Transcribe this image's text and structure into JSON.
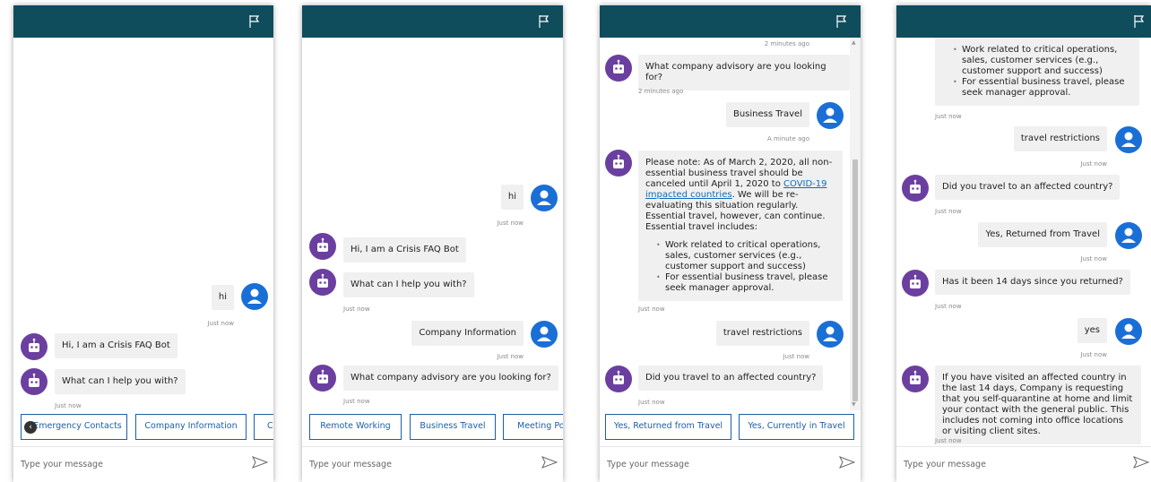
{
  "colors": {
    "header": "#0f4c5c",
    "bot_avatar": "#6b3fa0",
    "user_avatar": "#1a6fd6",
    "suggestion_border": "#1b5fa8",
    "bubble_bg": "#f0f0f0"
  },
  "icons": {
    "flag": "flag-icon",
    "send": "send-icon",
    "bot": "bot-icon",
    "user": "user-icon",
    "scroll_left": "chevron-left-icon"
  },
  "input": {
    "placeholder": "Type your message"
  },
  "panel1": {
    "user_hi": "hi",
    "ts_hi": "Just now",
    "bot_intro": "Hi, I am a Crisis FAQ Bot",
    "bot_help": "What can I help you with?",
    "ts_bot": "Just now",
    "suggestions": [
      "Emergency Contacts",
      "Company Information",
      "C"
    ]
  },
  "panel2": {
    "user_hi": "hi",
    "ts_hi": "Just now",
    "bot_intro": "Hi, I am a Crisis FAQ Bot",
    "bot_help": "What can I help you with?",
    "ts_bot1": "Just now",
    "user_company": "Company Information",
    "ts_user2": "Just now",
    "bot_advisory": "What company advisory are you looking for?",
    "ts_bot2": "Just now",
    "suggestions": [
      "Remote Working",
      "Business Travel",
      "Meeting Po"
    ]
  },
  "panel3": {
    "ts_top": "2 minutes ago",
    "bot_advisory": "What company advisory are you looking for?",
    "ts_bot1": "2 minutes ago",
    "user_business": "Business Travel",
    "ts_user1": "A minute ago",
    "note_part1": "Please note:  As of March 2, 2020,  all non-essential business travel should be canceled until April 1, 2020 to ",
    "note_link": "COVID-19 impacted countries",
    "note_part2": ". We will be re-evaluating this situation regularly. Essential travel, however, can continue. Essential travel includes:",
    "note_bullets": [
      "Work related to critical operations, sales, customer services (e.g., customer support and success)",
      "For essential business travel, please seek manager approval."
    ],
    "ts_bot2": "Just now",
    "user_restrictions": "travel restrictions",
    "ts_user2": "Just now",
    "bot_affected": "Did you travel to an affected country?",
    "ts_bot3": "Just now",
    "suggestions": [
      "Yes, Returned from Travel",
      "Yes, Currently in Travel"
    ]
  },
  "panel4": {
    "note_bullets": [
      "Work related to critical operations, sales, customer services (e.g., customer support and success)",
      "For essential business travel, please seek manager approval."
    ],
    "ts_bot1": "Just now",
    "user_restrictions": "travel restrictions",
    "ts_user1": "Just now",
    "bot_affected": "Did you travel to an affected country?",
    "ts_bot2": "Just now",
    "user_returned": "Yes, Returned from Travel",
    "ts_user2": "Just now",
    "bot_14days": "Has it been 14 days since you returned?",
    "ts_bot3": "Just now",
    "user_yes": "yes",
    "ts_user3": "Just now",
    "bot_quarantine": "If you have visited an affected country in the last 14 days, Company is requesting that you self-quarantine at home and limit your contact with the general public. This includes not coming into office locations or visiting client sites.",
    "ts_bot4": "Just now"
  }
}
